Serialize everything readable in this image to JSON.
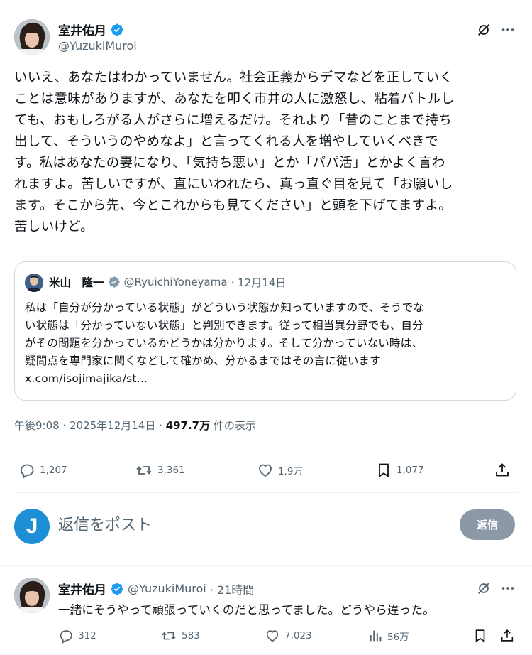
{
  "tweet": {
    "author_name": "室井佑月",
    "author_handle": "@YuzukiMuroi",
    "lines": [
      "いいえ、あなたはわかっていません。社会正義からデマなどを正していく",
      "ことは意味がありますが、あなたを叩く市井の人に激怒し、粘着バトルし",
      "ても、おもしろがる人がさらに増えるだけ。それより「昔のことまで持ち",
      "出して、そういうのやめなよ」と言ってくれる人を増やしていくべきで",
      "す。私はあなたの妻になり、「気持ち悪い」とか「パパ活」とかよく言わ",
      "れますよ。苦しいですが、直にいわれたら、真っ直ぐ目を見て「お願いし",
      "ます。そこから先、今とこれからも見てください」と頭を下げてますよ。",
      "苦しいけど。"
    ],
    "timestamp": "午後9:08 · 2025年12月14日 · ",
    "views_count": "497.7万",
    "views_label": " 件の表示",
    "counts": {
      "replies": "1,207",
      "retweets": "3,361",
      "likes": "1.9万",
      "bookmarks": "1,077"
    }
  },
  "quote": {
    "author_name": "米山　隆一",
    "author_handle": "@RyuichiYoneyama",
    "date": "· 12月14日",
    "lines": [
      "私は「自分が分かっている状態」がどういう状態か知っていますので、そうでな",
      "い状態は「分かっていない状態」と判別できます。従って相当異分野でも、自分",
      "がその問題を分かっているかどうかは分かります。そして分かっていない時は、",
      "疑問点を専門家に聞くなどして確かめ、分かるまではその言に従います",
      "x.com/isojimajika/st..."
    ]
  },
  "compose": {
    "avatar_letter": "J",
    "placeholder": "返信をポスト",
    "button": "返信"
  },
  "reply": {
    "author_name": "室井佑月",
    "author_handle": "@YuzukiMuroi",
    "time": "· 21時間",
    "text": "一緒にそうやって頑張っていくのだと思ってました。どうやら違った。",
    "counts": {
      "replies": "312",
      "retweets": "583",
      "likes": "7,023",
      "views": "56万"
    }
  },
  "colors": {
    "verified": "#1d9bf0",
    "muted": "#536471",
    "border": "#cfd9de",
    "reply_button": "#8b98a5"
  },
  "icons": [
    "grok-icon",
    "more-icon",
    "verified-icon",
    "reply-icon",
    "retweet-icon",
    "like-icon",
    "bookmark-icon",
    "share-icon",
    "views-icon"
  ]
}
